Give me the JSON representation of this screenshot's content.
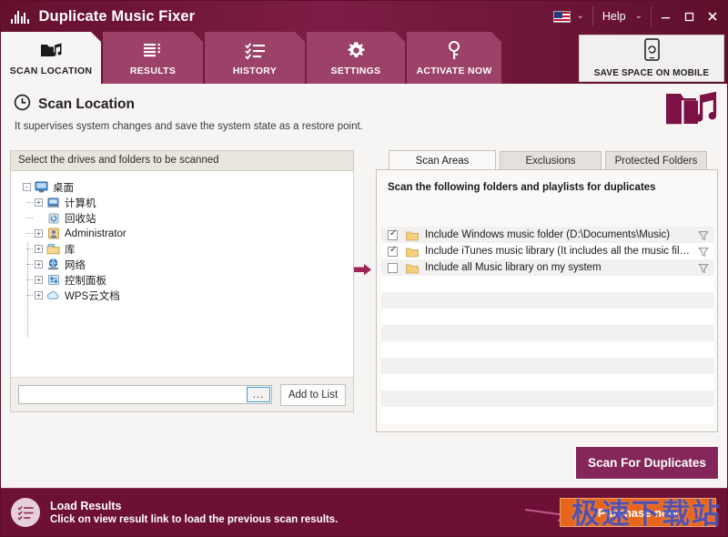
{
  "window": {
    "title": "Duplicate Music Fixer",
    "logo_icon": "audio-waveform-icon",
    "language_icon": "us-flag-icon",
    "language_chevron": "⌄",
    "help_label": "Help",
    "help_chevron": "⌄",
    "minimize_icon": "minimize-icon",
    "maximize_icon": "maximize-icon",
    "close_icon": "close-icon",
    "titlebar_color": "#6d1136"
  },
  "nav": {
    "tabs": [
      {
        "label": "SCAN LOCATION",
        "icon": "folder-music-icon",
        "active": true
      },
      {
        "label": "RESULTS",
        "icon": "list-lines-icon",
        "active": false
      },
      {
        "label": "HISTORY",
        "icon": "checklist-icon",
        "active": false
      },
      {
        "label": "SETTINGS",
        "icon": "gear-icon",
        "active": false
      },
      {
        "label": "ACTIVATE NOW",
        "icon": "key-icon",
        "active": false
      }
    ],
    "save_mobile": {
      "label": "SAVE SPACE ON MOBILE",
      "icon": "mobile-refresh-icon"
    },
    "active_tab_bg": "#f7f5f4",
    "inactive_tab_bg": "#9c4167"
  },
  "page": {
    "title": "Scan Location",
    "title_icon": "clock-icon",
    "subtitle": "It supervises system changes and save the system state as a restore point.",
    "brand_logo_icon": "folder-music-logo",
    "brand_color": "#7d1146"
  },
  "left_panel": {
    "header": "Select the drives and folders to be scanned",
    "tree": [
      {
        "label": "桌面",
        "icon": "desktop-icon",
        "expander": "-",
        "level": 0
      },
      {
        "label": "计算机",
        "icon": "computer-icon",
        "expander": "+",
        "level": 1
      },
      {
        "label": "回收站",
        "icon": "recycle-bin-icon",
        "expander": "",
        "level": 1
      },
      {
        "label": "Administrator",
        "icon": "user-icon",
        "expander": "+",
        "level": 1
      },
      {
        "label": "库",
        "icon": "library-folder-icon",
        "expander": "+",
        "level": 1
      },
      {
        "label": "网络",
        "icon": "network-icon",
        "expander": "+",
        "level": 1
      },
      {
        "label": "控制面板",
        "icon": "control-panel-icon",
        "expander": "+",
        "level": 1
      },
      {
        "label": "WPS云文档",
        "icon": "cloud-icon",
        "expander": "+",
        "level": 1
      }
    ],
    "path_value": "",
    "path_placeholder": "",
    "browse_label": "...",
    "add_to_list_label": "Add to List"
  },
  "mid_arrow_icon": "arrow-right-icon",
  "right_panel": {
    "tabs": [
      {
        "label": "Scan Areas",
        "active": true
      },
      {
        "label": "Exclusions",
        "active": false
      },
      {
        "label": "Protected Folders",
        "active": false
      }
    ],
    "heading": "Scan the following folders and playlists for duplicates",
    "rows": [
      {
        "checked": true,
        "label": "Include Windows music folder (D:\\Documents\\Music)",
        "folder_icon": "folder-icon",
        "filter_icon": "filter-icon"
      },
      {
        "checked": true,
        "label": "Include iTunes music library (It includes all the music files p...",
        "folder_icon": "folder-icon",
        "filter_icon": "filter-icon"
      },
      {
        "checked": false,
        "label": "Include all Music library on my system",
        "folder_icon": "folder-icon",
        "filter_icon": "filter-icon"
      }
    ],
    "empty_row_count": 9
  },
  "scan_button": {
    "label": "Scan For Duplicates",
    "color": "#84265a"
  },
  "footer": {
    "icon": "checklist-circle-icon",
    "title": "Load Results",
    "subtitle": "Click on view result link to load the previous scan results.",
    "arrow_icon": "arrow-right-long-icon",
    "purchase_label": "Purchase now",
    "purchase_color": "#e8661c",
    "watermark": "极速下载站"
  }
}
